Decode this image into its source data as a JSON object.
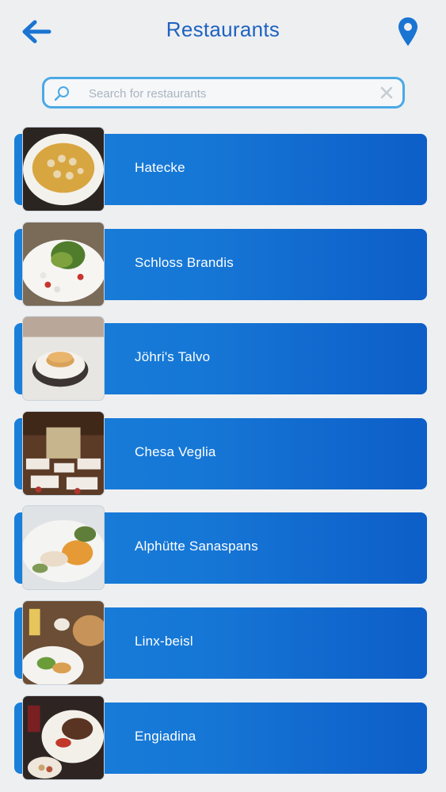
{
  "header": {
    "title": "Restaurants",
    "back_icon": "arrow-left-icon",
    "location_icon": "map-pin-icon",
    "accent": "#1f63c0"
  },
  "search": {
    "placeholder": "Search for restaurants",
    "value": "",
    "border_color": "#4aa9e6"
  },
  "restaurants": [
    {
      "name": "Hatecke",
      "image": "soup-bowl"
    },
    {
      "name": "Schloss Brandis",
      "image": "salad-plate"
    },
    {
      "name": "Jöhri's Talvo",
      "image": "pancake-plate"
    },
    {
      "name": "Chesa Veglia",
      "image": "dining-hall"
    },
    {
      "name": "Alphütte Sanaspans",
      "image": "seafood-platter"
    },
    {
      "name": "Linx-beisl",
      "image": "breakfast-table"
    },
    {
      "name": "Engiadina",
      "image": "steak-dinner"
    }
  ],
  "colors": {
    "row_gradient_start": "#1a7fd9",
    "row_gradient_end": "#0d5ec8",
    "background": "#eeeff1"
  }
}
